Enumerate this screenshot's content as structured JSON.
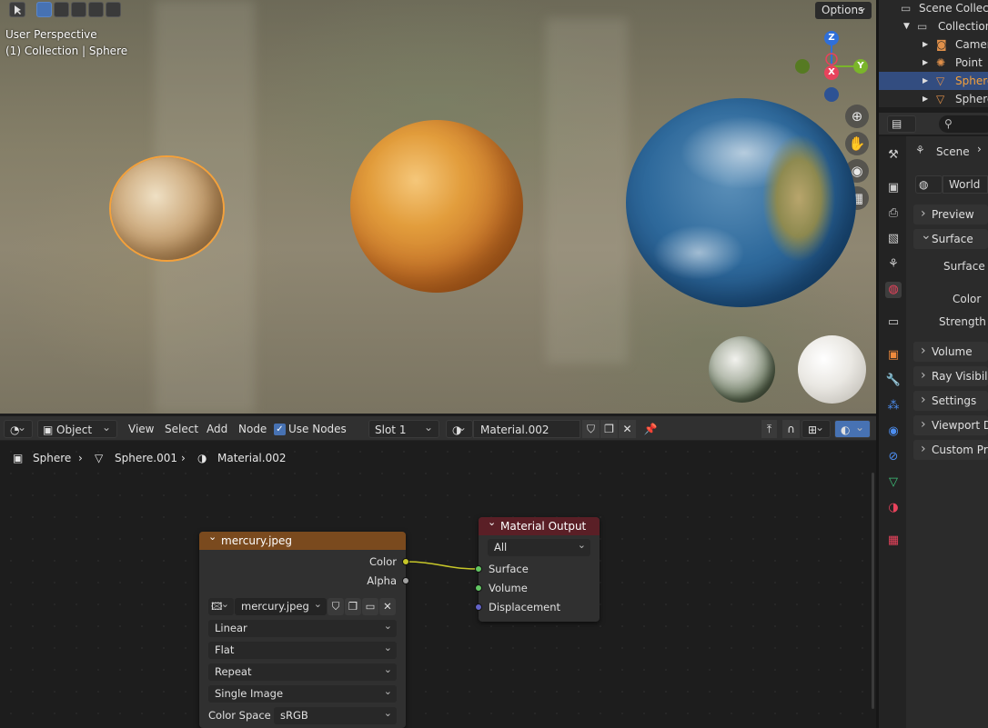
{
  "viewport": {
    "options_label": "Options",
    "overlay_line1": "User Perspective",
    "overlay_line2": "(1) Collection | Sphere",
    "gizmo": {
      "z": "Z",
      "x": "X",
      "y": "Y"
    },
    "nav_icons": [
      "zoom-icon",
      "hand-icon",
      "camera-icon",
      "grid-icon"
    ]
  },
  "node_header": {
    "editor_type_icon": "node-editor-icon",
    "mode": "Object",
    "menu": [
      "View",
      "Select",
      "Add",
      "Node"
    ],
    "use_nodes_label": "Use Nodes",
    "use_nodes_checked": true,
    "slot": "Slot 1",
    "material_name": "Material.002"
  },
  "breadcrumb": {
    "object": "Sphere",
    "mesh": "Sphere.001",
    "material": "Material.002"
  },
  "image_node": {
    "title": "mercury.jpeg",
    "outputs": [
      "Color",
      "Alpha"
    ],
    "image_name": "mercury.jpeg",
    "interpolation": "Linear",
    "projection": "Flat",
    "extension": "Repeat",
    "source": "Single Image",
    "color_space_label": "Color Space",
    "color_space": "sRGB",
    "header_color": "#7a4a1e"
  },
  "output_node": {
    "title": "Material Output",
    "target": "All",
    "inputs": [
      "Surface",
      "Volume",
      "Displacement"
    ],
    "header_color": "#5a1f26"
  },
  "outliner": {
    "rows": [
      {
        "label": "Scene Collection"
      },
      {
        "label": "Collection"
      },
      {
        "label": "Camera"
      },
      {
        "label": "Point"
      },
      {
        "label": "Sphere"
      },
      {
        "label": "Sphere"
      }
    ]
  },
  "properties": {
    "scene_label": "Scene",
    "world_label": "World",
    "sections": {
      "preview": "Preview",
      "surface": "Surface",
      "volume": "Volume",
      "ray_visibility": "Ray Visibility",
      "settings": "Settings",
      "viewport_display": "Viewport Display",
      "custom_props": "Custom Properties"
    },
    "fields": {
      "surface": "Surface",
      "color": "Color",
      "strength": "Strength"
    }
  },
  "colors": {
    "accent_blue": "#4772b3",
    "selection_orange": "#f5a13a",
    "socket_yellow": "#c7c729",
    "socket_green": "#63c763",
    "socket_grey": "#a1a1a1",
    "socket_purple": "#6363c7"
  }
}
